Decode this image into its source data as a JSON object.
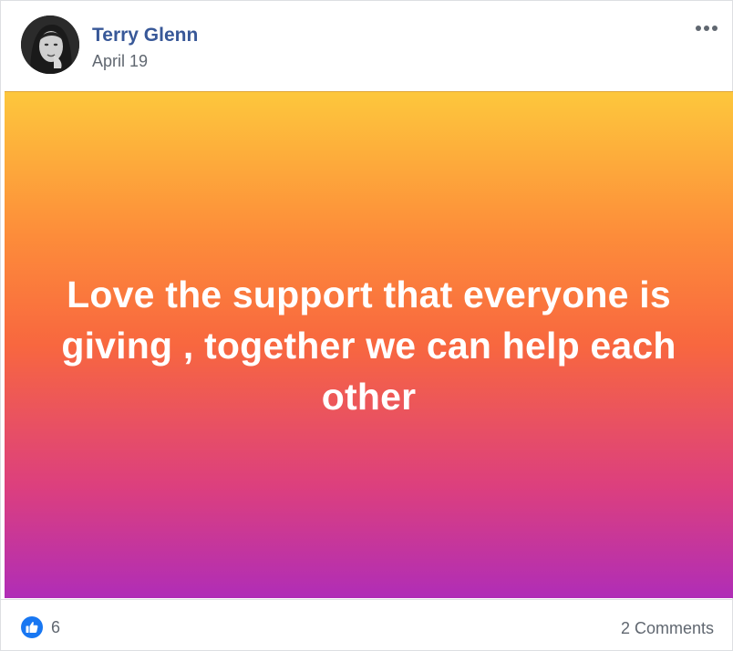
{
  "post": {
    "author": {
      "name": "Terry Glenn",
      "avatar_icon": "profile-photo"
    },
    "date": "April 19",
    "more_options_icon": "ellipsis-icon",
    "text": "Love the support that everyone is giving , together we can help each other",
    "background": {
      "gradient_colors": [
        "#fdc73c",
        "#fd8d3a",
        "#f8673f",
        "#dc3f7e",
        "#b02db7"
      ]
    },
    "reactions": {
      "icon": "like-icon",
      "count": "6"
    },
    "comments_label": "2 Comments"
  },
  "colors": {
    "author_name": "#385898",
    "meta_text": "#606770",
    "like_blue": "#1877f2"
  }
}
